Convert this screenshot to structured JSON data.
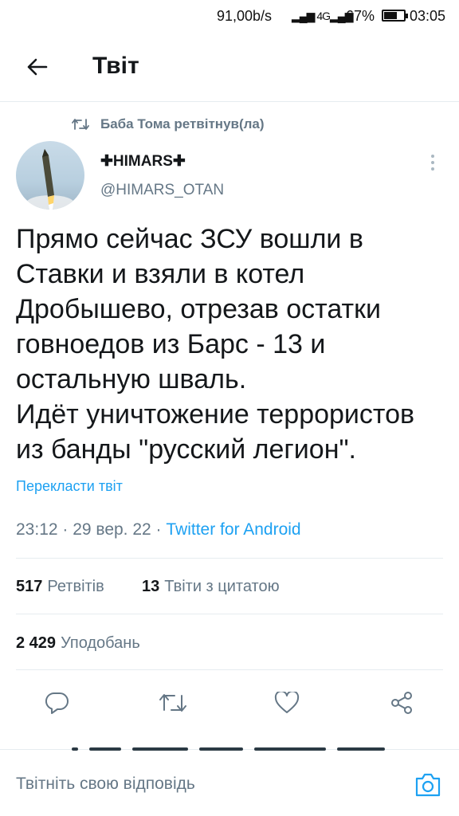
{
  "status_bar": {
    "speed": "91,00b/s",
    "signal": "4G",
    "battery": "67%",
    "time": "03:05"
  },
  "header": {
    "title": "Твіт",
    "back_icon": "arrow-left-icon"
  },
  "retweet_context": {
    "text": "Баба Тома ретвітнув(ла)",
    "icon": "retweet-icon"
  },
  "author": {
    "name": "✚HIMARS✚",
    "handle": "@HIMARS_OTAN"
  },
  "tweet": {
    "text": "Прямо сейчас ЗСУ вошли в Ставки и взяли в котел Дробышево, отрезав остатки говноедов из Барс - 13 и остальную шваль.\nИдёт уничтожение террористов из банды \"русский легион\".",
    "translate_label": "Перекласти твіт",
    "timestamp": "23:12 · 29 вер. 22 · ",
    "source": "Twitter for Android"
  },
  "stats": {
    "retweets_count": "517",
    "retweets_label": "Ретвітів",
    "quotes_count": "13",
    "quotes_label": "Твіти з цитатою",
    "likes_count": "2 429",
    "likes_label": "Уподобань"
  },
  "actions": [
    "reply-icon",
    "retweet-icon",
    "like-icon",
    "share-icon"
  ],
  "reply": {
    "placeholder": "Твітніть свою відповідь",
    "camera_icon": "camera-icon"
  },
  "colors": {
    "accent": "#1da1f2",
    "secondary_text": "#657786",
    "primary_text": "#14171a",
    "divider": "#e6ecf0"
  }
}
